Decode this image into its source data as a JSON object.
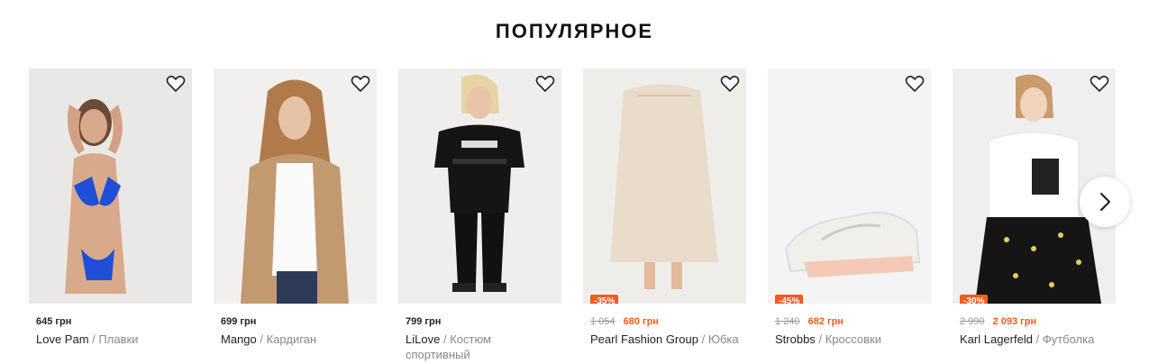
{
  "section": {
    "title": "ПОПУЛЯРНОЕ"
  },
  "products": [
    {
      "price": "645 грн",
      "old_price": "",
      "discount": "",
      "brand": "Love Pam",
      "type": "Плавки"
    },
    {
      "price": "699 грн",
      "old_price": "",
      "discount": "",
      "brand": "Mango",
      "type": "Кардиган"
    },
    {
      "price": "799 грн",
      "old_price": "",
      "discount": "",
      "brand": "LiLove",
      "type": "Костюм спортивный"
    },
    {
      "price": "680 грн",
      "old_price": "1 054",
      "discount": "-35%",
      "brand": "Pearl Fashion Group",
      "type": "Юбка"
    },
    {
      "price": "682 грн",
      "old_price": "1 240",
      "discount": "-45%",
      "brand": "Strobbs",
      "type": "Кроссовки"
    },
    {
      "price": "2 093 грн",
      "old_price": "2 990",
      "discount": "-30%",
      "brand": "Karl Lagerfeld",
      "type": "Футболка"
    }
  ],
  "separator": "/",
  "icons": {
    "favorite": "heart-icon",
    "next": "chevron-right-icon"
  },
  "colors": {
    "discount": "#f35b1f",
    "title": "#111111"
  }
}
